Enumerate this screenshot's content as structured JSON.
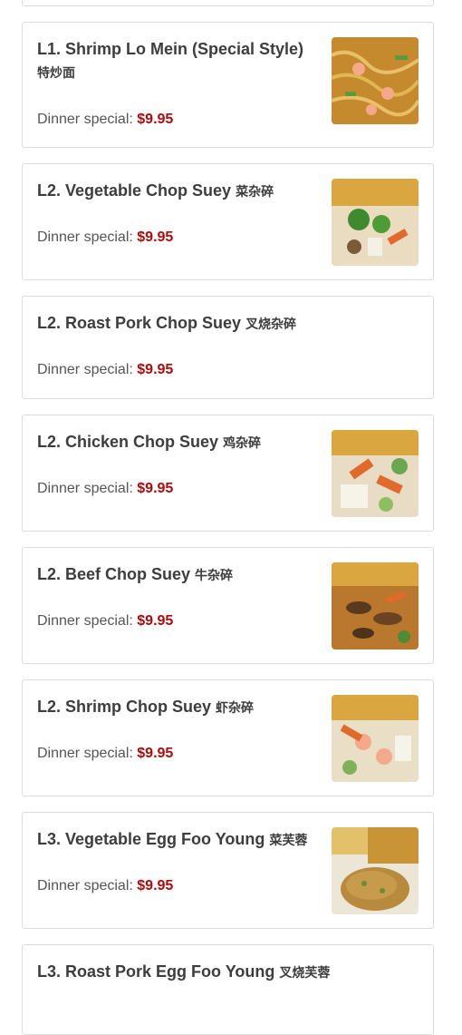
{
  "menu": {
    "items": [
      {
        "name": "L1. Shrimp Lo Mein (Special Style)",
        "chinese": "特炒面",
        "price_label": "Dinner special:",
        "price": "$9.95",
        "has_image": true,
        "image": "shrimp-lo-mein"
      },
      {
        "name": "L2. Vegetable Chop Suey",
        "chinese": "菜杂碎",
        "price_label": "Dinner special:",
        "price": "$9.95",
        "has_image": true,
        "image": "vegetable-chop-suey"
      },
      {
        "name": "L2. Roast Pork Chop Suey",
        "chinese": "叉烧杂碎",
        "price_label": "Dinner special:",
        "price": "$9.95",
        "has_image": false
      },
      {
        "name": "L2. Chicken Chop Suey",
        "chinese": "鸡杂碎",
        "price_label": "Dinner special:",
        "price": "$9.95",
        "has_image": true,
        "image": "chicken-chop-suey"
      },
      {
        "name": "L2. Beef Chop Suey",
        "chinese": "牛杂碎",
        "price_label": "Dinner special:",
        "price": "$9.95",
        "has_image": true,
        "image": "beef-chop-suey"
      },
      {
        "name": "L2. Shrimp Chop Suey",
        "chinese": "虾杂碎",
        "price_label": "Dinner special:",
        "price": "$9.95",
        "has_image": true,
        "image": "shrimp-chop-suey"
      },
      {
        "name": "L3. Vegetable Egg Foo Young",
        "chinese": "菜芙蓉",
        "price_label": "Dinner special:",
        "price": "$9.95",
        "has_image": true,
        "image": "vegetable-egg-foo-young"
      },
      {
        "name": "L3. Roast Pork Egg Foo Young",
        "chinese": "叉烧芙蓉",
        "price_label": "",
        "price": "",
        "has_image": false
      }
    ]
  },
  "colors": {
    "price": "#b10a0a",
    "title": "#3d3d3d",
    "border": "#dcdcdc"
  }
}
